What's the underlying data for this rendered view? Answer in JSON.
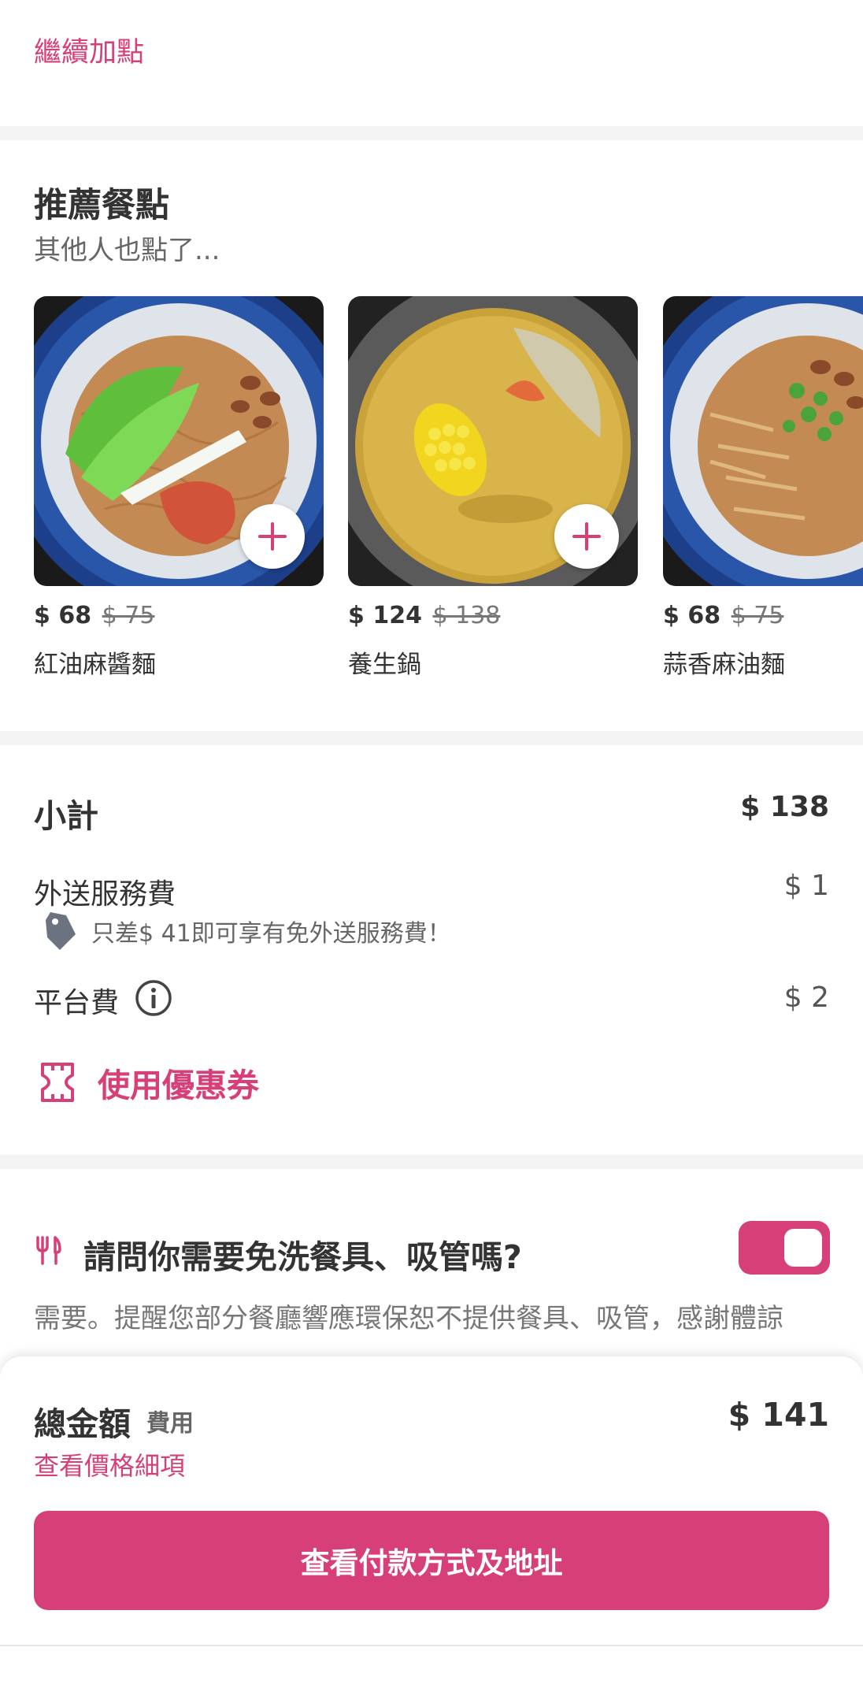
{
  "cart": {
    "continue_label": "繼續加點"
  },
  "recommended": {
    "title": "推薦餐點",
    "subtitle": "其他人也點了...",
    "items": [
      {
        "price": "$ 68",
        "old_price": "$ 75",
        "name": "紅油麻醬麵",
        "image": "noodle-with-greens",
        "has_add": true
      },
      {
        "price": "$ 124",
        "old_price": "$ 138",
        "name": "養生鍋",
        "image": "soup-pot",
        "has_add": true
      },
      {
        "price": "$ 68",
        "old_price": "$ 75",
        "name": "蒜香麻油麵",
        "image": "noodle-with-scallion",
        "has_add": false
      }
    ]
  },
  "summary": {
    "subtotal_label": "小計",
    "subtotal_value": "$ 138",
    "delivery_label": "外送服務費",
    "delivery_value": "$ 1",
    "delivery_hint": "只差$ 41即可享有免外送服務費！",
    "platform_label": "平台費",
    "platform_value": "$ 2",
    "coupon_label": "使用優惠券"
  },
  "cutlery": {
    "question": "請問你需要免洗餐具、吸管嗎?",
    "toggle_on": true,
    "description": "需要。提醒您部分餐廳響應環保恕不提供餐具、吸管，感謝體諒"
  },
  "checkout": {
    "total_label": "總金額",
    "fee_label": "費用",
    "total_value": "$ 141",
    "detail_link": "查看價格細項",
    "pay_button": "查看付款方式及地址"
  },
  "colors": {
    "accent": "#d63f77",
    "text": "#333333",
    "muted": "#777777",
    "divider": "#f4f4f4"
  }
}
